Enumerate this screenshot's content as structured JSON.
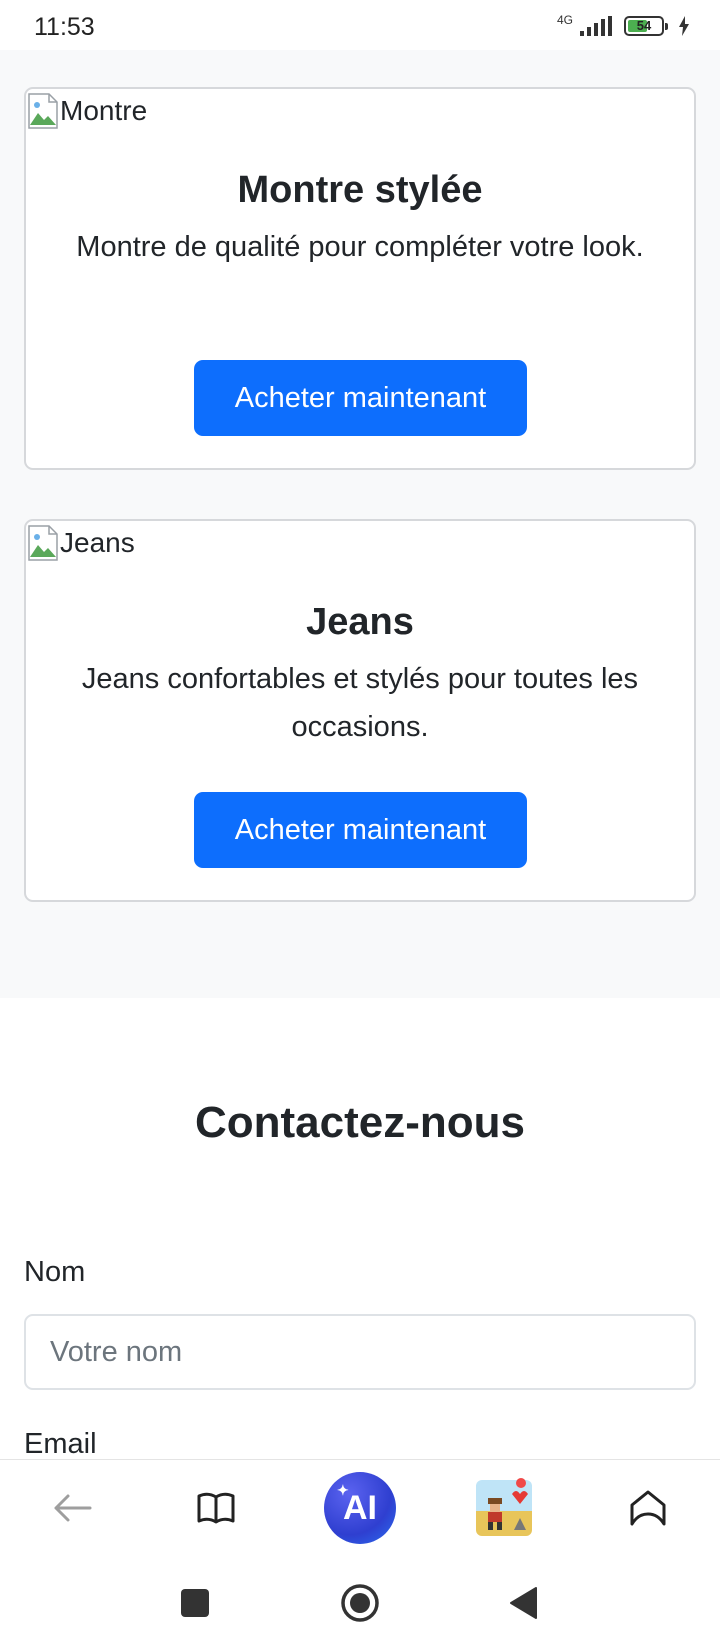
{
  "status": {
    "time": "11:53",
    "network": "4G",
    "battery": "54",
    "battery_level": 0.54,
    "icons": [
      "signal-icon",
      "battery-icon",
      "charging-icon"
    ]
  },
  "products": [
    {
      "image_alt": "Montre",
      "title": "Montre stylée",
      "description": "Montre de qualité pour compléter votre look.",
      "button": "Acheter maintenant"
    },
    {
      "image_alt": "Jeans",
      "title": "Jeans",
      "description": "Jeans confortables et stylés pour toutes les occasions.",
      "button": "Acheter maintenant"
    }
  ],
  "contact": {
    "title": "Contactez-nous",
    "name_label": "Nom",
    "name_placeholder": "Votre nom",
    "name_value": "",
    "email_label": "Email"
  },
  "browser_toolbar": {
    "items": [
      "back-icon",
      "book-icon",
      "ai-icon",
      "game-icon",
      "home-icon"
    ],
    "ai_label": "AI"
  },
  "nav_bar": {
    "items": [
      "recents-icon",
      "home-icon",
      "back-icon"
    ]
  },
  "colors": {
    "primary": "#0d6efd",
    "section_bg": "#f8f9fa",
    "text": "#212529",
    "ai_gradient": "#2f3fd0"
  }
}
